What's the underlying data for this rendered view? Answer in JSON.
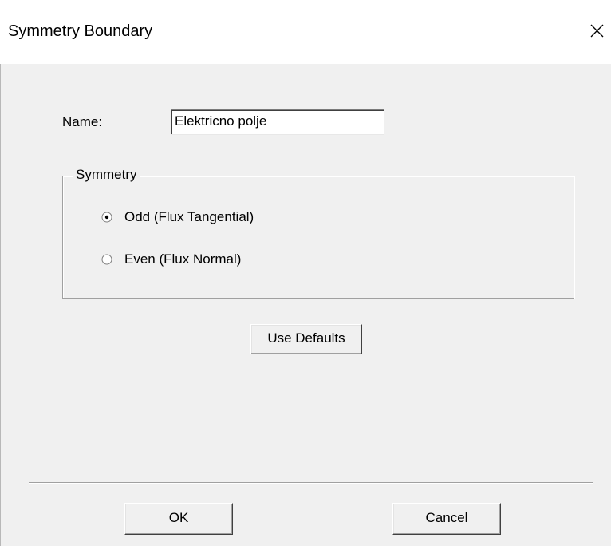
{
  "dialog": {
    "title": "Symmetry Boundary",
    "close_icon": "close-icon"
  },
  "name_field": {
    "label": "Name:",
    "value": "Elektricno polje"
  },
  "symmetry_group": {
    "legend": "Symmetry",
    "options": [
      {
        "label": "Odd  (Flux Tangential)",
        "selected": true
      },
      {
        "label": "Even (Flux Normal)",
        "selected": false
      }
    ]
  },
  "buttons": {
    "use_defaults": "Use Defaults",
    "ok": "OK",
    "cancel": "Cancel"
  }
}
